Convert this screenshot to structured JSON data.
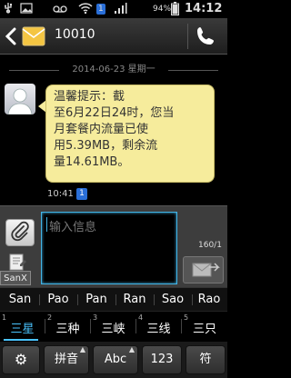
{
  "status_bar": {
    "sim_badge": "1",
    "battery_percent": "94%",
    "time": "14:12",
    "icons": [
      "usb-icon",
      "image-icon",
      "voicemail-icon",
      "wifi-icon",
      "signal-icon",
      "battery-icon"
    ]
  },
  "header": {
    "contact_name": "10010"
  },
  "conversation": {
    "date": "2014-06-23 星期一",
    "message_text": "温馨提示：截\n至6月22日24时，您当\n月套餐内流量已使\n用5.39MB，剩余流\n量14.61MB。",
    "message_time": "10:41",
    "message_sim": "1"
  },
  "compose": {
    "placeholder": "输入信息",
    "char_count": "160/1",
    "ime_label": "SanX"
  },
  "keyboard": {
    "suggestions": [
      "San",
      "Pao",
      "Pan",
      "Ran",
      "Sao",
      "Rao"
    ],
    "candidates": [
      {
        "num": "1",
        "text": "三星"
      },
      {
        "num": "2",
        "text": "三种"
      },
      {
        "num": "3",
        "text": "三峡"
      },
      {
        "num": "4",
        "text": "三线"
      },
      {
        "num": "5",
        "text": "三只"
      }
    ],
    "keys": {
      "settings": "⚙",
      "pinyin": "拼音",
      "abc": "Abc",
      "numbers": "123",
      "symbols": "符"
    }
  },
  "colors": {
    "bubble": "#f6ec9c",
    "accent_blue": "#42b4e6",
    "sim_blue": "#2a6fd8"
  }
}
